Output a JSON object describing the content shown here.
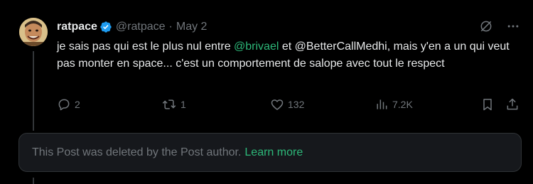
{
  "post": {
    "display_name": "ratpace",
    "handle": "@ratpace",
    "separator": "·",
    "date": "May 2",
    "text_before": "je sais pas qui est le plus nul entre ",
    "mention": "@brivael",
    "text_after": " et @BetterCallMedhi, mais y'en a un qui veut pas monter en space... c'est un comportement de salope avec tout le respect"
  },
  "actions": {
    "replies": "2",
    "reposts": "1",
    "likes": "132",
    "views": "7.2K"
  },
  "deleted_notice": {
    "text": "This Post was deleted by the Post author.",
    "link": "Learn more"
  },
  "colors": {
    "accent": "#2db879",
    "verified": "#1d9bf0",
    "muted": "#71767b",
    "text": "#e7e9ea",
    "background": "#000000"
  },
  "icons": [
    "verified-badge-icon",
    "grok-slash-icon",
    "more-icon",
    "reply-icon",
    "repost-icon",
    "like-icon",
    "views-icon",
    "bookmark-icon",
    "share-icon"
  ]
}
